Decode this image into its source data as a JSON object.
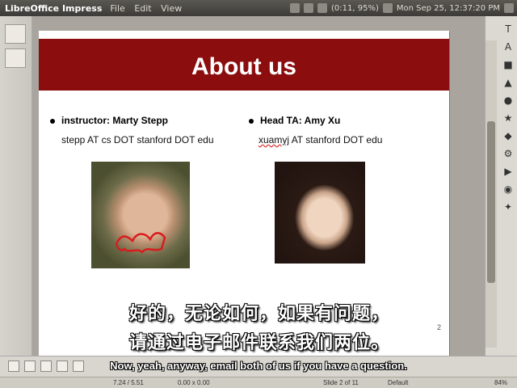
{
  "topbar": {
    "app_name": "LibreOffice Impress",
    "menus": [
      "File",
      "Edit",
      "View"
    ],
    "battery": "(0:11, 95%)",
    "clock": "Mon Sep 25, 12:37:20 PM"
  },
  "slide": {
    "title": "About us",
    "instructor_label": "instructor: Marty Stepp",
    "instructor_email": "stepp AT cs DOT stanford DOT edu",
    "ta_label": "Head TA: Amy Xu",
    "ta_email_user": "xuamyj",
    "ta_email_rest": " AT stanford DOT edu",
    "page_number": "2"
  },
  "subtitles": {
    "chinese_line1": "好的，无论如何，如果有问题，",
    "chinese_line2": "请通过电子邮件联系我们两位。",
    "english": "Now, yeah, anyway, email both of us if you have a question."
  },
  "statusbar": {
    "position": "7.24 / 5.51",
    "size": "0.00 x 0.00",
    "slide_info": "Slide 2 of 11",
    "layout": "Default",
    "zoom": "84%"
  },
  "right_tools": [
    "T",
    "A",
    "■",
    "▲",
    "●",
    "★",
    "◆",
    "⚙",
    "▶",
    "◉",
    "✦"
  ]
}
